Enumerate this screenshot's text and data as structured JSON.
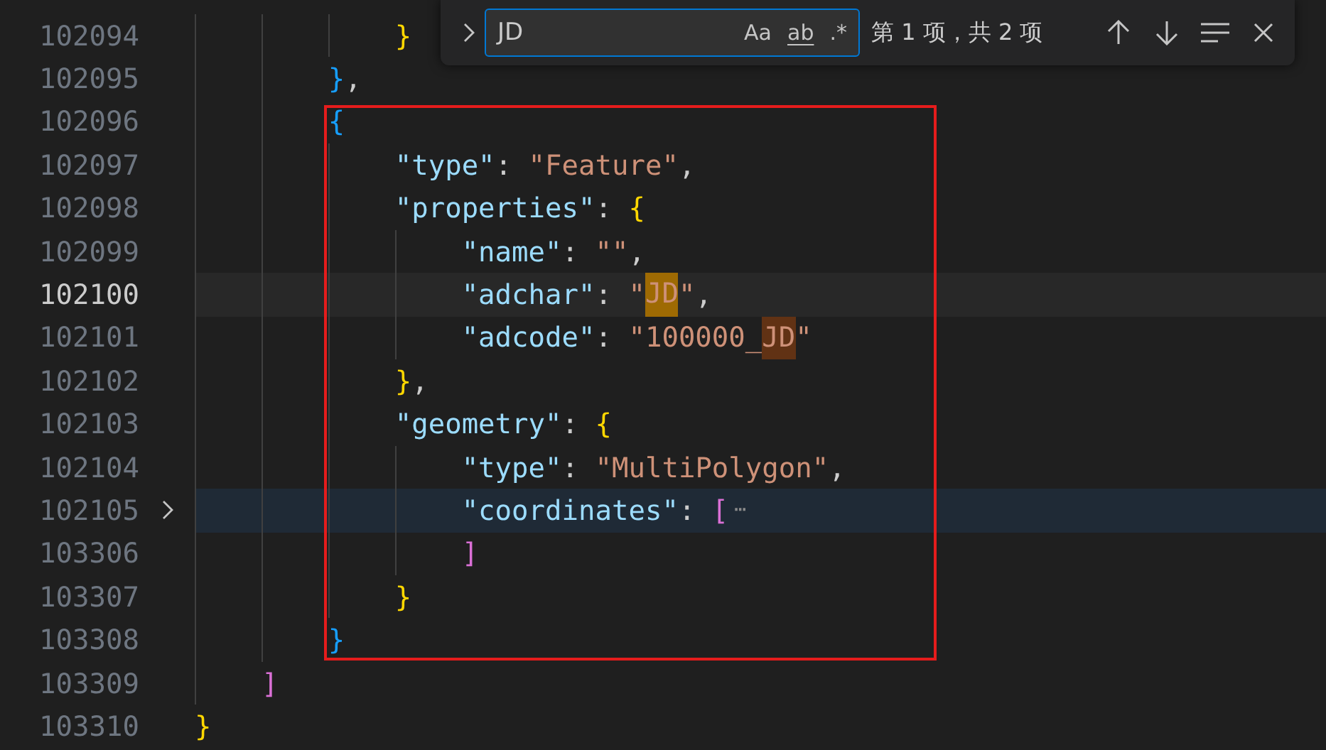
{
  "editor": {
    "lines": [
      {
        "number": "102094",
        "current": false,
        "folded": false,
        "tokens": [
          {
            "kind": "bracket1",
            "text": "            }"
          }
        ]
      },
      {
        "number": "102095",
        "current": false,
        "folded": false,
        "tokens": [
          {
            "kind": "bracket2",
            "text": "        }"
          },
          {
            "kind": "punct",
            "text": ","
          }
        ]
      },
      {
        "number": "102096",
        "current": false,
        "folded": false,
        "tokens": [
          {
            "kind": "bracket2",
            "text": "        {"
          }
        ]
      },
      {
        "number": "102097",
        "current": false,
        "folded": false,
        "tokens": [
          {
            "kind": "key",
            "text": "            \"type\""
          },
          {
            "kind": "punct",
            "text": ": "
          },
          {
            "kind": "string",
            "text": "\"Feature\""
          },
          {
            "kind": "punct",
            "text": ","
          }
        ]
      },
      {
        "number": "102098",
        "current": false,
        "folded": false,
        "tokens": [
          {
            "kind": "key",
            "text": "            \"properties\""
          },
          {
            "kind": "punct",
            "text": ": "
          },
          {
            "kind": "bracket1",
            "text": "{"
          }
        ]
      },
      {
        "number": "102099",
        "current": false,
        "folded": false,
        "tokens": [
          {
            "kind": "key",
            "text": "                \"name\""
          },
          {
            "kind": "punct",
            "text": ": "
          },
          {
            "kind": "string",
            "text": "\"\""
          },
          {
            "kind": "punct",
            "text": ","
          }
        ]
      },
      {
        "number": "102100",
        "current": true,
        "folded": false,
        "tokens": [
          {
            "kind": "key",
            "text": "                \"adchar\""
          },
          {
            "kind": "punct",
            "text": ": "
          },
          {
            "kind": "string",
            "text": "\""
          },
          {
            "kind": "match",
            "text": "JD",
            "selected": true
          },
          {
            "kind": "string",
            "text": "\""
          },
          {
            "kind": "punct",
            "text": ","
          }
        ]
      },
      {
        "number": "102101",
        "current": false,
        "folded": false,
        "tokens": [
          {
            "kind": "key",
            "text": "                \"adcode\""
          },
          {
            "kind": "punct",
            "text": ": "
          },
          {
            "kind": "string",
            "text": "\"100000_"
          },
          {
            "kind": "match",
            "text": "JD",
            "selected": false
          },
          {
            "kind": "string",
            "text": "\""
          }
        ]
      },
      {
        "number": "102102",
        "current": false,
        "folded": false,
        "tokens": [
          {
            "kind": "bracket1",
            "text": "            }"
          },
          {
            "kind": "punct",
            "text": ","
          }
        ]
      },
      {
        "number": "102103",
        "current": false,
        "folded": false,
        "tokens": [
          {
            "kind": "key",
            "text": "            \"geometry\""
          },
          {
            "kind": "punct",
            "text": ": "
          },
          {
            "kind": "bracket1",
            "text": "{"
          }
        ]
      },
      {
        "number": "102104",
        "current": false,
        "folded": false,
        "tokens": [
          {
            "kind": "key",
            "text": "                \"type\""
          },
          {
            "kind": "punct",
            "text": ": "
          },
          {
            "kind": "string",
            "text": "\"MultiPolygon\""
          },
          {
            "kind": "punct",
            "text": ","
          }
        ]
      },
      {
        "number": "102105",
        "current": false,
        "folded": true,
        "tokens": [
          {
            "kind": "key",
            "text": "                \"coordinates\""
          },
          {
            "kind": "punct",
            "text": ": "
          },
          {
            "kind": "bracket3",
            "text": "["
          },
          {
            "kind": "fold",
            "text": "⋯"
          }
        ]
      },
      {
        "number": "103306",
        "current": false,
        "folded": false,
        "tokens": [
          {
            "kind": "bracket3",
            "text": "                ]"
          }
        ]
      },
      {
        "number": "103307",
        "current": false,
        "folded": false,
        "tokens": [
          {
            "kind": "bracket1",
            "text": "            }"
          }
        ]
      },
      {
        "number": "103308",
        "current": false,
        "folded": false,
        "tokens": [
          {
            "kind": "bracket2",
            "text": "        }"
          }
        ]
      },
      {
        "number": "103309",
        "current": false,
        "folded": false,
        "tokens": [
          {
            "kind": "bracket3",
            "text": "    ]"
          }
        ]
      },
      {
        "number": "103310",
        "current": false,
        "folded": false,
        "tokens": [
          {
            "kind": "bracket1",
            "text": "}"
          }
        ]
      }
    ]
  },
  "find_widget": {
    "value": "JD",
    "options": [
      {
        "label": "Aa",
        "kind": "case",
        "on": false
      },
      {
        "label": "ab",
        "kind": "word",
        "on": false
      },
      {
        "label": ".*",
        "kind": "regex",
        "on": false
      }
    ],
    "result": "第 1 项，共 2 项"
  }
}
